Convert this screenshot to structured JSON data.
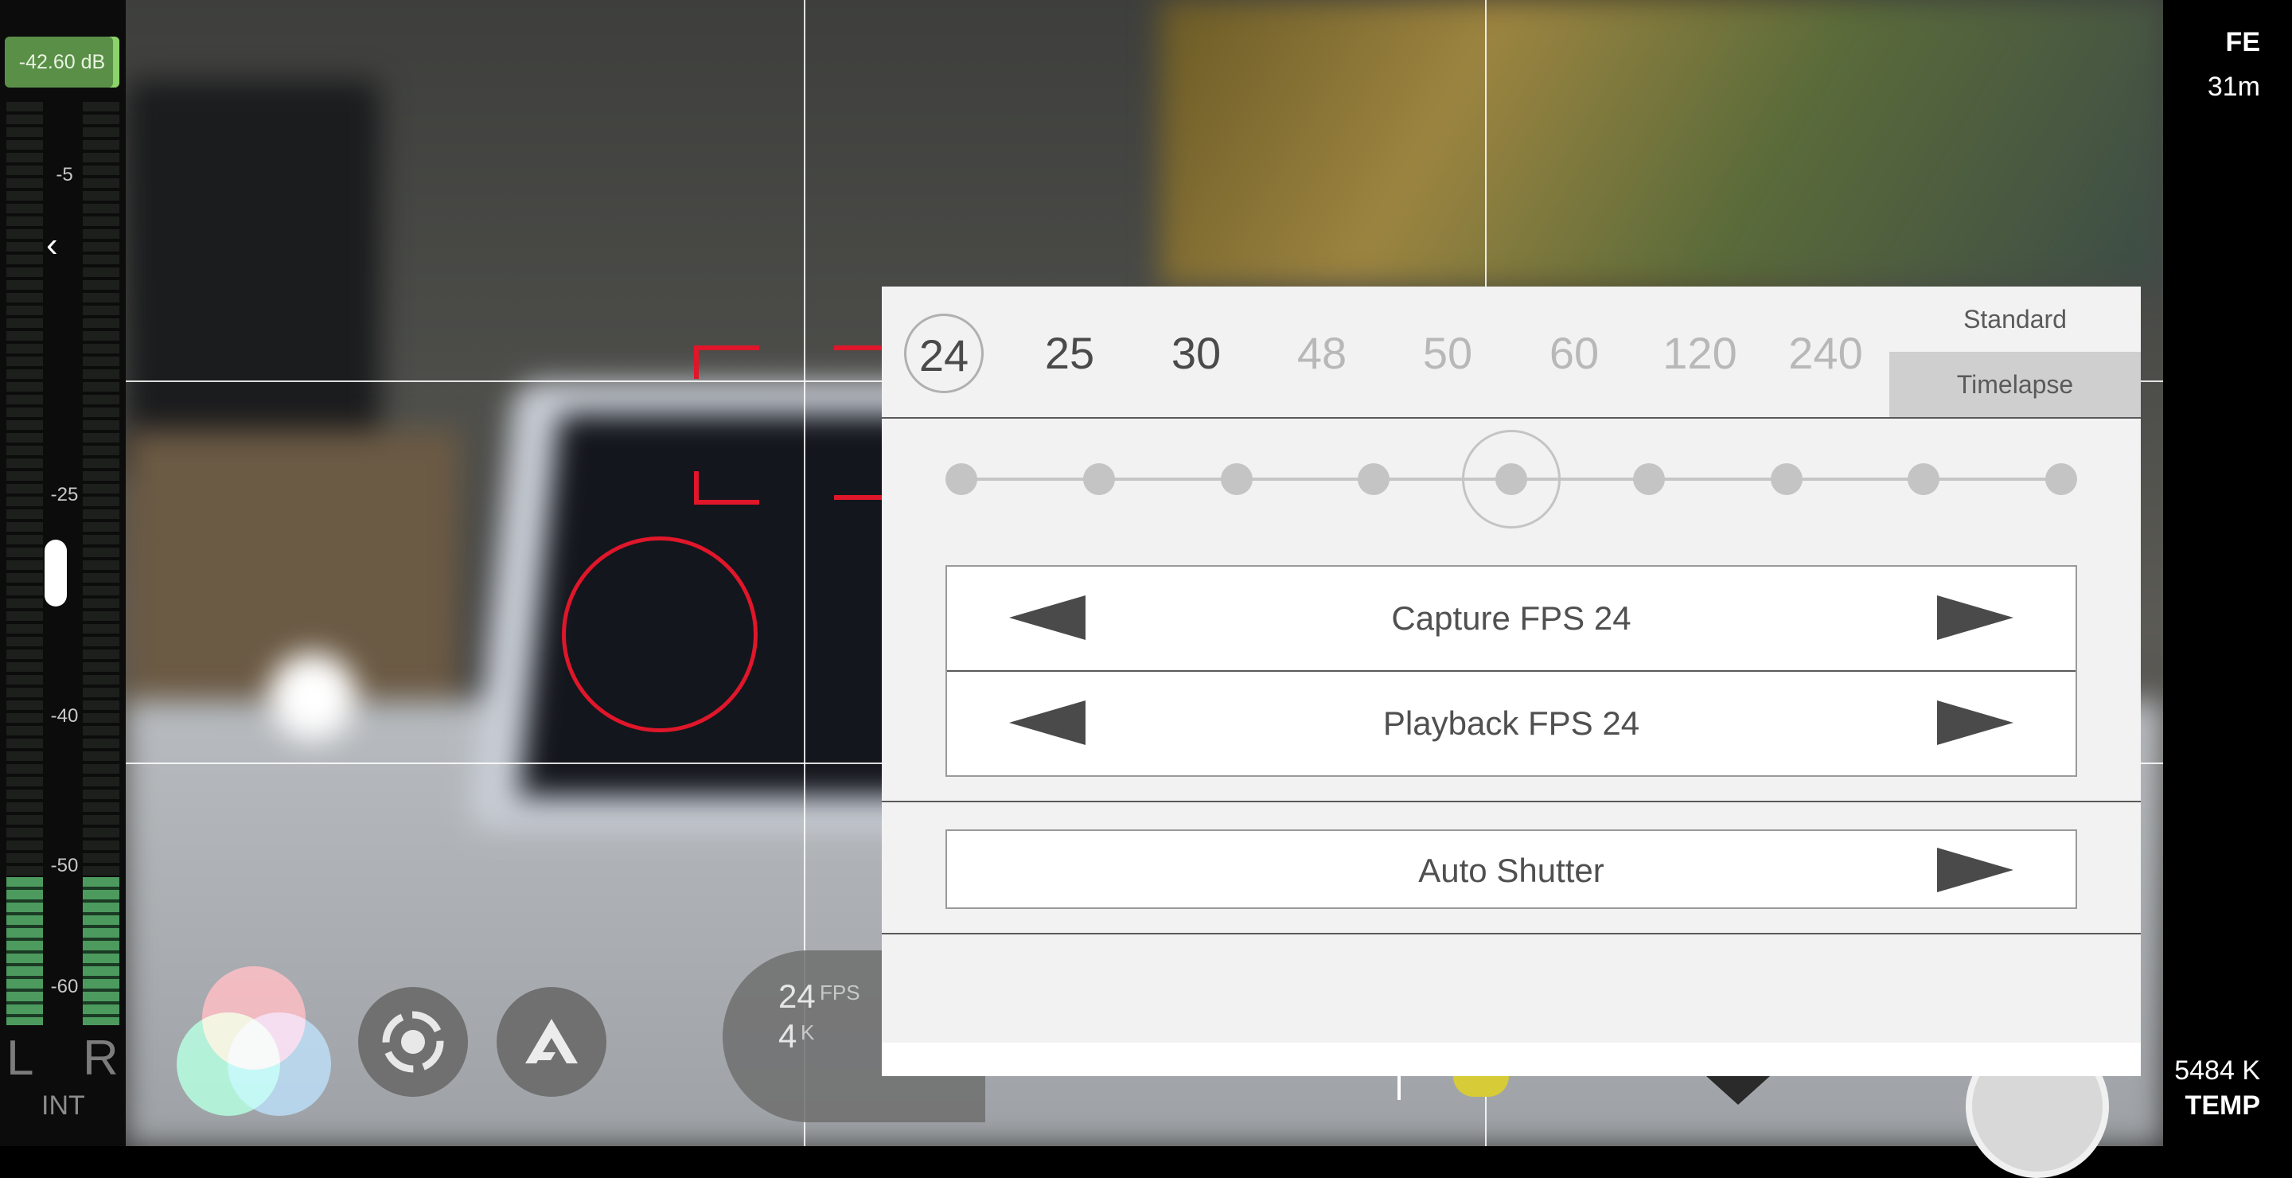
{
  "audio_meter": {
    "db_readout": "-42.60 dB",
    "scale": [
      "-5",
      "-25",
      "-40",
      "-50",
      "-60"
    ],
    "left_channel": "L",
    "right_channel": "R",
    "input_source": "INT",
    "left_level": 0.16,
    "right_level": 0.16
  },
  "status": {
    "lens": "FE",
    "record_time": "31m",
    "white_balance_value": "5484 K",
    "white_balance_label": "TEMP"
  },
  "bottom_bar": {
    "fps_value": "24",
    "fps_unit": "FPS",
    "resolution_value": "4",
    "resolution_unit": "K"
  },
  "fps_panel": {
    "frame_rates": [
      "24",
      "25",
      "30",
      "48",
      "50",
      "60",
      "120",
      "240"
    ],
    "selected_frame_rate": "24",
    "modes": [
      "Standard",
      "Timelapse"
    ],
    "active_mode": "Timelapse",
    "slider_stops": 9,
    "slider_selected_index": 4,
    "capture_fps_label": "Capture FPS 24",
    "playback_fps_label": "Playback FPS 24",
    "auto_shutter_label": "Auto Shutter"
  },
  "colors": {
    "focus_red": "#e0162a",
    "meter_green": "#4c9a5e",
    "panel_bg": "#f2f2f2"
  }
}
